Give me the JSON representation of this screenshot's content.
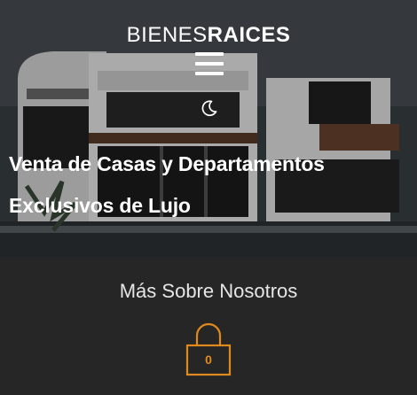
{
  "header": {
    "logo_light": "BIENES",
    "logo_bold": "RAICES",
    "menu_icon": "hamburger-icon",
    "theme_icon": "moon-icon"
  },
  "hero": {
    "headline_line1": "Venta de Casas y Departamentos",
    "headline_line2": "Exclusivos de Lujo"
  },
  "about": {
    "title": "Más Sobre Nosotros",
    "icon": "lock-icon",
    "icon_text": "0"
  },
  "colors": {
    "background_dark": "#262626",
    "text_white": "#ffffff",
    "accent": "#e08a1e"
  }
}
